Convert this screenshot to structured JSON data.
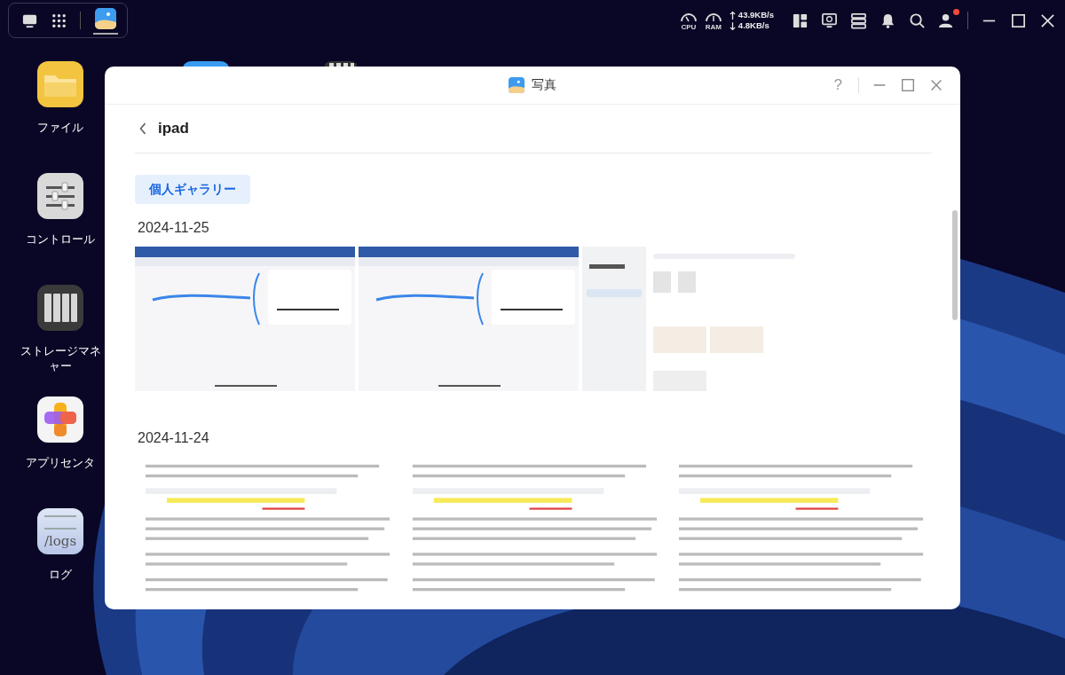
{
  "taskbar": {
    "apps": [
      {
        "kind": "photos",
        "selected": true
      }
    ],
    "cpu_label": "CPU",
    "ram_label": "RAM",
    "upload": "43.9KB/s",
    "download": "4.8KB/s",
    "user_notification": true
  },
  "desktop_icons": [
    {
      "kind": "files",
      "label": [
        "ファイル"
      ]
    },
    {
      "kind": "control",
      "label": [
        "コントロール"
      ]
    },
    {
      "kind": "storage",
      "label": [
        "ストレージマネ",
        "ャー"
      ]
    },
    {
      "kind": "appcenter",
      "label": [
        "アプリセンタ"
      ]
    },
    {
      "kind": "logs",
      "label": [
        "ログ"
      ],
      "icon_text": "/logs"
    }
  ],
  "window": {
    "title": "写真",
    "help": "?",
    "folder": "ipad",
    "album_chip": "個人ギャラリー",
    "groups": [
      {
        "date": "2024-11-25"
      },
      {
        "date": "2024-11-24"
      }
    ]
  }
}
